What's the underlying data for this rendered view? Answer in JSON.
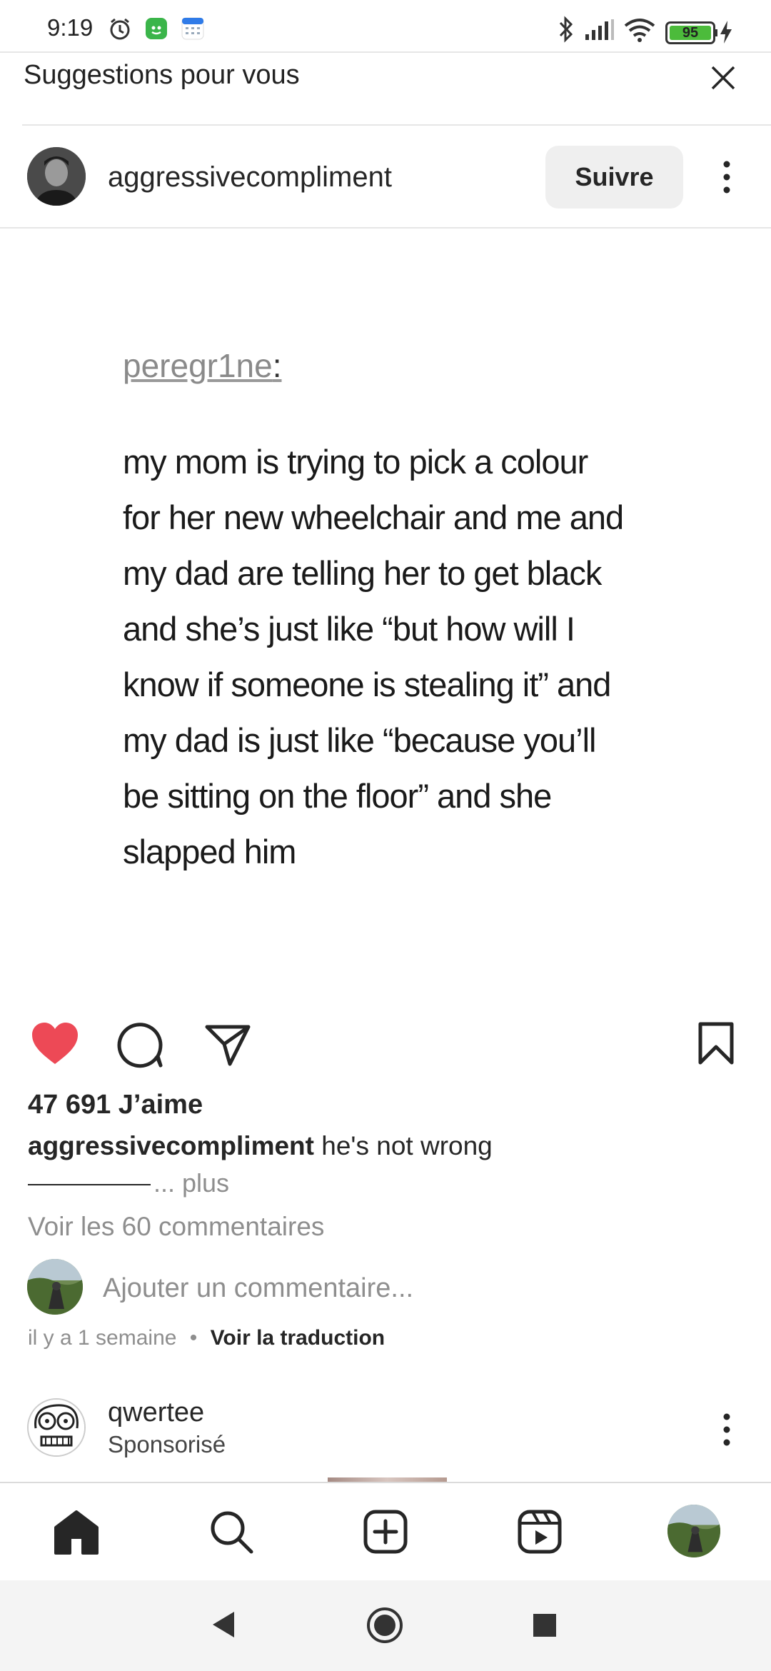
{
  "status_bar": {
    "time": "9:19",
    "battery": "95"
  },
  "suggestions": {
    "title": "Suggestions pour vous"
  },
  "post": {
    "username": "aggressivecompliment",
    "follow_label": "Suivre",
    "content": {
      "handle": "peregr1ne",
      "colon": ":",
      "lines": [
        "my mom is trying to pick a colour",
        "for her new wheelchair and me and",
        "my dad are telling her to get black",
        "and she’s just like “but how will I",
        "know if someone is stealing it” and",
        "my dad is just like “because you’ll",
        "be sitting on the floor” and she",
        "slapped him"
      ]
    },
    "likes": "47 691 J’aime",
    "caption_user": "aggressivecompliment",
    "caption_text": " he's not wrong",
    "more_label": "... plus",
    "view_comments": "Voir les 60 commentaires",
    "add_comment_placeholder": "Ajouter un commentaire...",
    "time_ago": "il y a 1 semaine",
    "separator": "•",
    "see_translation": "Voir la traduction",
    "liked": true
  },
  "next_post": {
    "username": "qwertee",
    "sponsored": "Sponsorisé"
  },
  "colors": {
    "like_red": "#ed4956",
    "follow_bg": "#efefef",
    "secondary_text": "#8e8e8e"
  },
  "icons": {
    "like": "heart-icon",
    "comment": "comment-icon",
    "share": "paper-plane-icon",
    "save": "bookmark-icon",
    "home": "home-icon",
    "search": "search-icon",
    "create": "plus-square-icon",
    "reels": "reels-icon"
  }
}
